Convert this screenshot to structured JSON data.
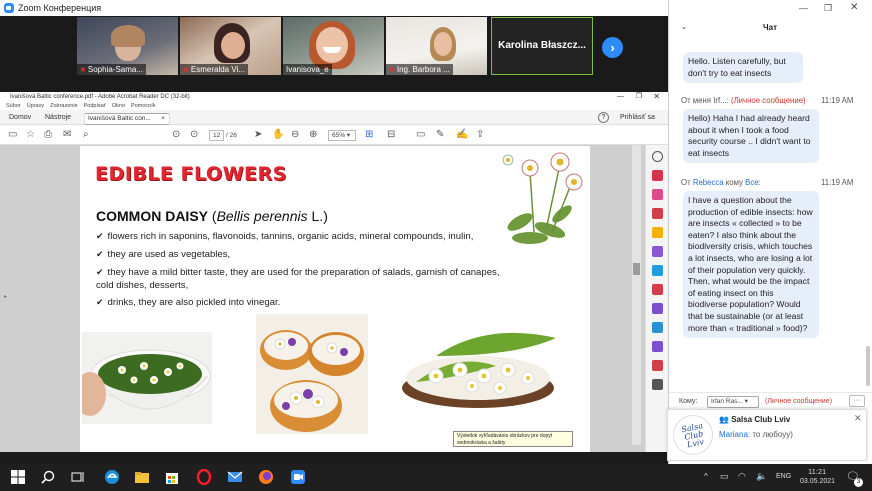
{
  "zoom": {
    "window_title": "Zoom Конференция",
    "participants": [
      {
        "name": "Sophia-Sama..."
      },
      {
        "name": "Esmeralda Vi..."
      },
      {
        "name": "Ivanisova_e"
      },
      {
        "name": "Ing. Barbora ..."
      },
      {
        "name": "Karolina  Błaszcz..."
      }
    ]
  },
  "acrobat": {
    "title": "Ivanišová Baltic conference.pdf - Adobe Acrobat Reader DC (32-bit)",
    "menu": [
      "Súbor",
      "Úpravy",
      "Zobrazenie",
      "Podpísať",
      "Okno",
      "Pomocník"
    ],
    "tabs": [
      "Domov",
      "Nástroje",
      "Ivanišová Baltic con..."
    ],
    "tab_close": "×",
    "page_current": "12",
    "page_total": "/ 26",
    "zoom": "65%",
    "signin": "Prihlásiť sa",
    "tooltip": "Výsledok vyhľadávania obrázkov pre dopyt sedmokráska a šaláty"
  },
  "slide": {
    "title": "EDIBLE FLOWERS",
    "subtitle_bold": "COMMON DAISY",
    "subtitle_paren_open": " (",
    "subtitle_italic": "Bellis perennis",
    "subtitle_rest": " L.)",
    "bullets": [
      "flowers rich in saponins, flavonoids, tannins, organic acids, mineral compounds, inulin,",
      "they are used as vegetables,",
      "they have a mild bitter taste, they are used for the preparation of salads, garnish of canapes, cold dishes, desserts,",
      "drinks, they are also pickled into vinegar."
    ]
  },
  "chat": {
    "title": "Чат",
    "messages": [
      {
        "meta_from": "",
        "text": "Hello. Listen carefully, but don't try to eat insects"
      },
      {
        "meta_from": "От меня Irf...",
        "meta_tag": "(Личное сообщение)",
        "time": "11:19 AM",
        "text": "Hello) Haha I had already heard about it when I took a food security course .. I didn't want to eat insects"
      },
      {
        "meta_prefix": "От",
        "meta_from": "Rebecca",
        "meta_mid": "кому",
        "meta_to": "Все:",
        "time": "11:19 AM",
        "text": "I have a question about the production of edible insects: how are insects « collected » to be eaten? I also think about the biodiversity crisis, which touches a lot insects, who are losing a lot of their population very quickly. Then, what would be the impact of eating insect on this biodiverse population? Would that be sustainable (or at least more than « traditional » food)?"
      }
    ],
    "to_label": "Кому:",
    "to_value": "Irfan Ras...",
    "to_tag": "(Личное сообщение)",
    "more": "···"
  },
  "notification": {
    "group": "Salsa Club Lviv",
    "sender": "Mariana:",
    "text": "то любоуу)",
    "logo_text": "Salsa Club Lviv"
  },
  "taskbar": {
    "lang": "ENG",
    "time": "11:21",
    "date": "03.05.2021",
    "notif_count": "3"
  }
}
